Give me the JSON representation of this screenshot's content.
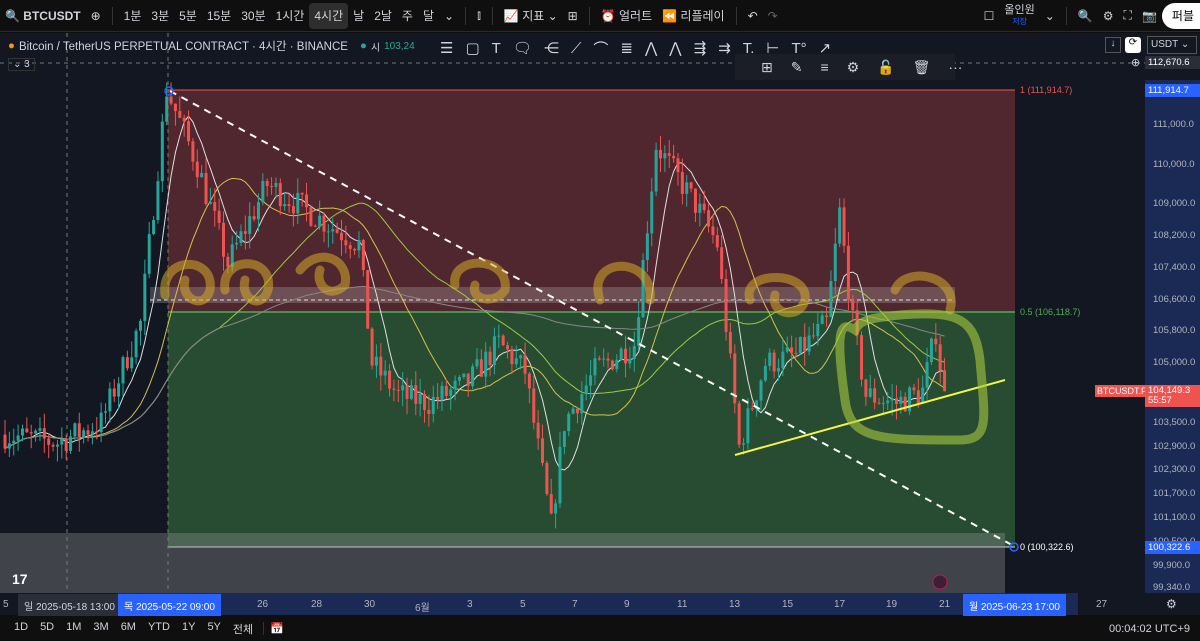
{
  "toolbar": {
    "symbol": "BTCUSDT",
    "intervals": [
      "1분",
      "3분",
      "5분",
      "15분",
      "30분",
      "1시간",
      "4시간",
      "날",
      "2날",
      "주",
      "달"
    ],
    "active_interval": "4시간",
    "indicators": "지표",
    "alert": "얼러트",
    "replay": "리플레이",
    "layout_name": "올인원",
    "layout_status": "저장",
    "publish": "퍼블"
  },
  "legend": {
    "title": "Bitcoin / TetherUS PERPETUAL CONTRACT · 4시간 · BINANCE",
    "open_label": "시",
    "open_value": "103,24",
    "collapse": "3"
  },
  "price_panel": {
    "currency": "USDT",
    "crosshair_price": "112,670.6"
  },
  "price_axis": {
    "ticks": [
      "111,000.0",
      "110,000.0",
      "109,000.0",
      "108,200.0",
      "107,400.0",
      "106,600.0",
      "105,800.0",
      "105,000.0",
      "103,500.0",
      "102,900.0",
      "102,300.0",
      "101,700.0",
      "101,100.0",
      "100,500.0",
      "99,900.0",
      "99,340.0"
    ],
    "high_tag": "111,914.7",
    "low_tag": "100,322.6",
    "last_symbol": "BTCUSDT.P",
    "last_price": "104,149.3",
    "countdown": "55:57"
  },
  "fib": {
    "level1": "1 (111,914.7)",
    "level05": "0.5 (106,118.7)",
    "level0": "0 (100,322.6)"
  },
  "time_axis": {
    "left_edge": "5",
    "cursor1": "일 2025-05-18   13:00",
    "cursor2": "목 2025-05-22   09:00",
    "cursor3": "월 2025-06-23   17:00",
    "ticks": [
      "26",
      "28",
      "30",
      "6월",
      "3",
      "5",
      "7",
      "9",
      "11",
      "13",
      "15",
      "17",
      "19",
      "21",
      "27"
    ]
  },
  "ranges": [
    "1D",
    "5D",
    "1M",
    "3M",
    "6M",
    "YTD",
    "1Y",
    "5Y",
    "전체"
  ],
  "clock": "00:04:02 UTC+9",
  "colors": {
    "up": "#26a69a",
    "down": "#ef5350",
    "accent": "#2962ff"
  },
  "chart_data": {
    "type": "candlestick",
    "ylim": [
      99100,
      112900
    ],
    "price_path": [
      [
        0,
        103200
      ],
      [
        12,
        103000
      ],
      [
        22,
        103500
      ],
      [
        31,
        106000
      ],
      [
        37,
        111900
      ],
      [
        44,
        110000
      ],
      [
        51,
        107500
      ],
      [
        60,
        109500
      ],
      [
        67,
        109000
      ],
      [
        74,
        108500
      ],
      [
        81,
        108000
      ],
      [
        84,
        105000
      ],
      [
        90,
        104200
      ],
      [
        97,
        104000
      ],
      [
        106,
        104500
      ],
      [
        113,
        105500
      ],
      [
        119,
        104800
      ],
      [
        125,
        100900
      ],
      [
        128,
        103500
      ],
      [
        135,
        104800
      ],
      [
        144,
        105500
      ],
      [
        149,
        110500
      ],
      [
        158,
        109000
      ],
      [
        163,
        108000
      ],
      [
        168,
        102900
      ],
      [
        174,
        105000
      ],
      [
        181,
        105200
      ],
      [
        188,
        106000
      ],
      [
        191,
        108800
      ],
      [
        194,
        106000
      ],
      [
        197,
        104200
      ],
      [
        204,
        104000
      ],
      [
        210,
        104300
      ],
      [
        213,
        105800
      ],
      [
        215,
        104149
      ]
    ]
  }
}
